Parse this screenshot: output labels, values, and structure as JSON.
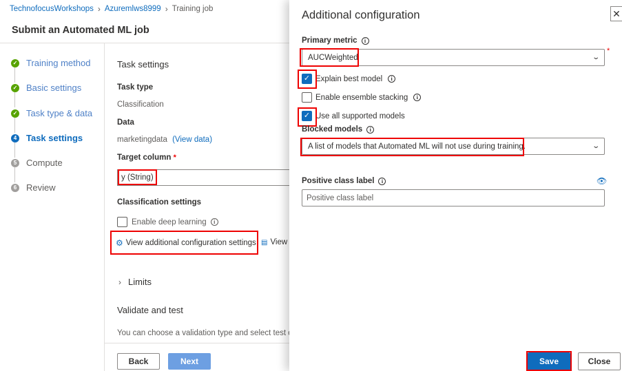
{
  "breadcrumb": {
    "workspace": "TechnofocusWorkshops",
    "resource": "Azuremlws8999",
    "current": "Training job"
  },
  "page": {
    "title": "Submit an Automated ML job"
  },
  "steps": [
    {
      "num": "",
      "label": "Training method",
      "state": "done"
    },
    {
      "num": "",
      "label": "Basic settings",
      "state": "done"
    },
    {
      "num": "",
      "label": "Task type & data",
      "state": "done"
    },
    {
      "num": "4",
      "label": "Task settings",
      "state": "current"
    },
    {
      "num": "5",
      "label": "Compute",
      "state": "todo"
    },
    {
      "num": "6",
      "label": "Review",
      "state": "todo"
    }
  ],
  "task_settings": {
    "title": "Task settings",
    "task_type_label": "Task type",
    "task_type_value": "Classification",
    "data_label": "Data",
    "data_value": "marketingdata",
    "view_data": "(View data)",
    "target_label": "Target column",
    "target_req": "*",
    "target_value": "y (String)",
    "classification_settings": "Classification settings",
    "enable_deep_learning": "Enable deep learning",
    "view_additional": "View additional configuration settings",
    "view_partial": "View",
    "limits": "Limits",
    "validate_title": "Validate and test",
    "validate_desc": "You can choose a validation type and select test data"
  },
  "footer": {
    "back": "Back",
    "next": "Next"
  },
  "panel": {
    "title": "Additional configuration",
    "primary_metric_label": "Primary metric",
    "primary_metric_value": "AUCWeighted",
    "required_mark": "*",
    "explain_best_model": "Explain best model",
    "enable_ensemble": "Enable ensemble stacking",
    "use_all_models": "Use all supported models",
    "blocked_models_label": "Blocked models",
    "blocked_models_placeholder": "A list of models that Automated ML will not use during training.",
    "positive_class_label": "Positive class label",
    "positive_class_placeholder": "Positive class label",
    "save": "Save",
    "close": "Close"
  },
  "checkboxes": {
    "explain_best_model": true,
    "enable_ensemble": false,
    "use_all_models": true,
    "enable_deep_learning": false
  },
  "colors": {
    "accent": "#0f6cbd",
    "success": "#57a300",
    "highlight": "#ee0000"
  }
}
